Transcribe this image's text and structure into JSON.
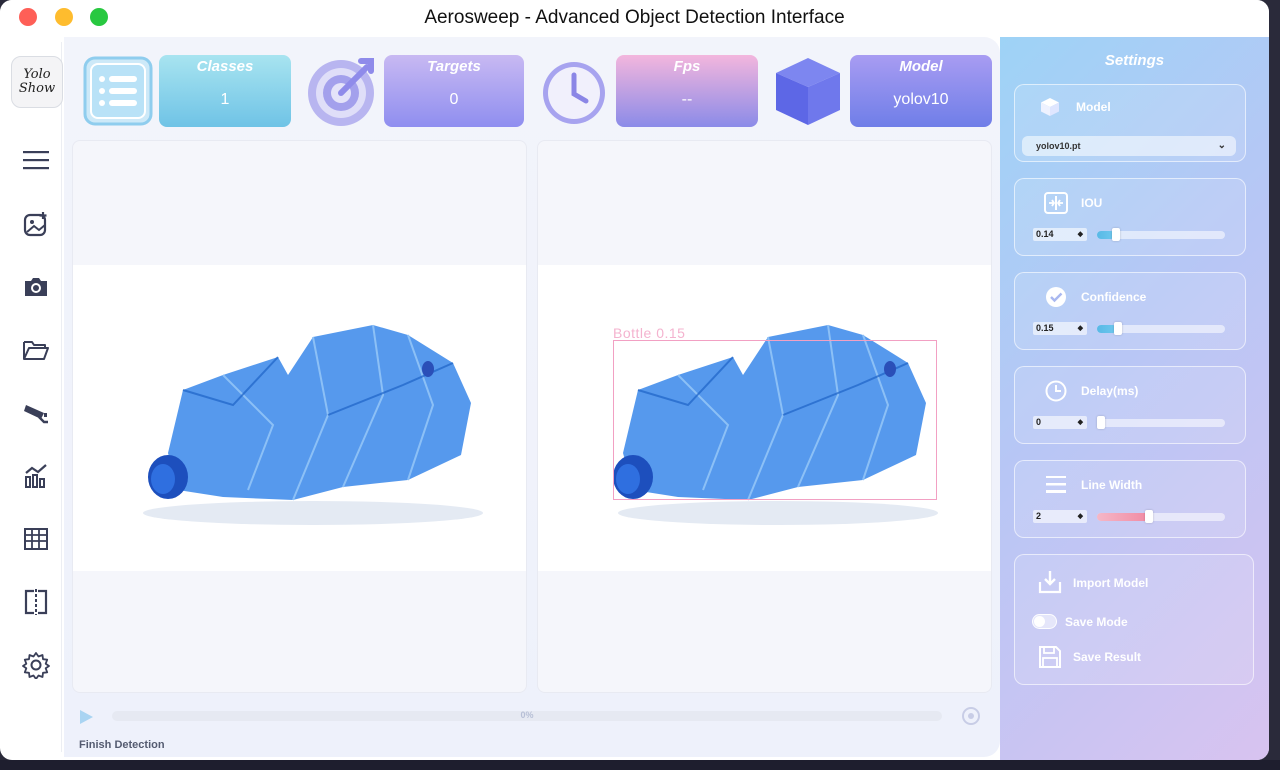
{
  "window": {
    "title": "Aerosweep - Advanced Object Detection Interface"
  },
  "logo": {
    "text": "Yolo Show"
  },
  "sidebar": {
    "items": [
      {
        "icon": "menu-icon"
      },
      {
        "icon": "image-add-icon"
      },
      {
        "icon": "camera-icon"
      },
      {
        "icon": "folder-icon"
      },
      {
        "icon": "cctv-icon"
      },
      {
        "icon": "chart-icon"
      },
      {
        "icon": "table-icon"
      },
      {
        "icon": "split-view-icon"
      },
      {
        "icon": "settings-gear-icon"
      }
    ]
  },
  "stats": {
    "classes": {
      "title": "Classes",
      "value": "1"
    },
    "targets": {
      "title": "Targets",
      "value": "0"
    },
    "fps": {
      "title": "Fps",
      "value": "--"
    },
    "model": {
      "title": "Model",
      "value": "yolov10"
    }
  },
  "detection": {
    "label": "Bottle  0.15"
  },
  "progress": {
    "value": 0,
    "text": "0%"
  },
  "status": {
    "text": "Finish Detection"
  },
  "settings": {
    "title": "Settings",
    "model": {
      "label": "Model",
      "selected": "yolov10.pt"
    },
    "iou": {
      "label": "IOU",
      "value": "0.14",
      "fraction": 0.14
    },
    "confidence": {
      "label": "Confidence",
      "value": "0.15",
      "fraction": 0.15
    },
    "delay": {
      "label": "Delay(ms)",
      "value": "0",
      "fraction": 0.0
    },
    "line_width": {
      "label": "Line Width",
      "value": "2",
      "fraction": 0.41
    },
    "import_model": {
      "label": "Import Model"
    },
    "save_mode": {
      "label": "Save Mode",
      "on": false
    },
    "save_result": {
      "label": "Save Result"
    }
  },
  "colors": {
    "accent_blue": "#6fc3e6",
    "accent_purple": "#8f8ef0",
    "bbox": "#f2a0c3",
    "bottle": "#3a82e0"
  }
}
